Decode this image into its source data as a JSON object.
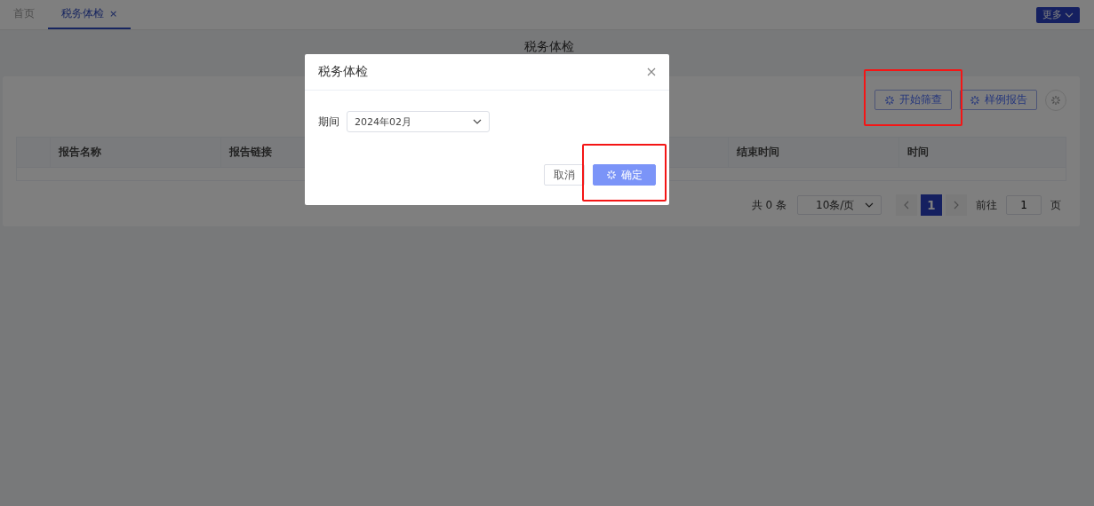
{
  "tabs": [
    {
      "label": "首页",
      "selected": false,
      "closable": false
    },
    {
      "label": "税务体检",
      "selected": true,
      "closable": true,
      "close_glyph": "×"
    }
  ],
  "more_button": {
    "label": "更多"
  },
  "page_title": "税务体检",
  "toolbar": [
    {
      "kind": "button",
      "label": "开始筛查",
      "highlighted": true
    },
    {
      "kind": "button",
      "label": "样例报告",
      "highlighted": false
    },
    {
      "kind": "round",
      "highlighted": false
    }
  ],
  "table": {
    "columns": [
      {
        "kind": "check"
      },
      {
        "label": "报告名称"
      },
      {
        "label": "报告链接",
        "kind": "wide"
      },
      {
        "label": "结束时间"
      },
      {
        "label": "时间"
      }
    ]
  },
  "pagination": {
    "total": "共 0 条",
    "page_size": "10条/页",
    "pages": [
      {
        "label": "1",
        "selected": true
      }
    ],
    "goto_label": "前往",
    "goto_value": "1",
    "goto_suffix": "页"
  },
  "dialog": {
    "title": "税务体检",
    "field_label": "期间",
    "field_value": "2024年02月",
    "buttons": [
      {
        "kind": "cancel",
        "label": "取消",
        "highlighted": false
      },
      {
        "kind": "primary",
        "label": "确定",
        "highlighted": true,
        "loading": true
      }
    ]
  }
}
